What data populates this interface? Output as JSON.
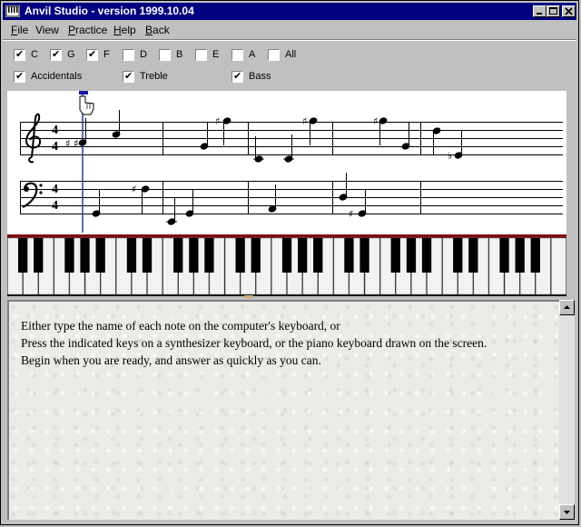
{
  "window": {
    "title": "Anvil Studio - version 1999.10.04"
  },
  "menu": [
    {
      "label": "File",
      "mnemonic": "F",
      "rest": "ile"
    },
    {
      "label": "View",
      "mnemonic": "",
      "rest": "View"
    },
    {
      "label": "Practice",
      "mnemonic": "P",
      "rest": "ractice"
    },
    {
      "label": "Help",
      "mnemonic": "H",
      "rest": "elp"
    },
    {
      "label": "Back",
      "mnemonic": "B",
      "rest": "ack"
    }
  ],
  "note_checkboxes": [
    {
      "label": "C",
      "checked": true
    },
    {
      "label": "G",
      "checked": true
    },
    {
      "label": "F",
      "checked": true
    },
    {
      "label": "D",
      "checked": false
    },
    {
      "label": "B",
      "checked": false
    },
    {
      "label": "E",
      "checked": false
    },
    {
      "label": "A",
      "checked": false
    },
    {
      "label": "All",
      "checked": false
    }
  ],
  "option_checkboxes": [
    {
      "label": "Accidentals",
      "checked": true
    },
    {
      "label": "Treble",
      "checked": true
    },
    {
      "label": "Bass",
      "checked": true
    }
  ],
  "check_glyph": "✔",
  "staff": {
    "time_signature_top": "4",
    "time_signature_bottom": "4",
    "sharp": "♯",
    "flat": "♭"
  },
  "instructions": [
    "Either type the name of each note on the computer's keyboard, or",
    "Press the indicated keys on a synthesizer keyboard, or the piano keyboard drawn on the screen.",
    "Begin when you are ready, and answer as quickly as you can."
  ],
  "colors": {
    "title_bar": "#000080",
    "cursor_line": "#2040a0",
    "panel": "#c0c0c0"
  },
  "icons": [
    "app-icon",
    "minimize-icon",
    "maximize-icon",
    "close-icon",
    "hand-pointer-icon",
    "treble-clef-icon",
    "bass-clef-icon",
    "scroll-up-icon",
    "scroll-down-icon"
  ]
}
